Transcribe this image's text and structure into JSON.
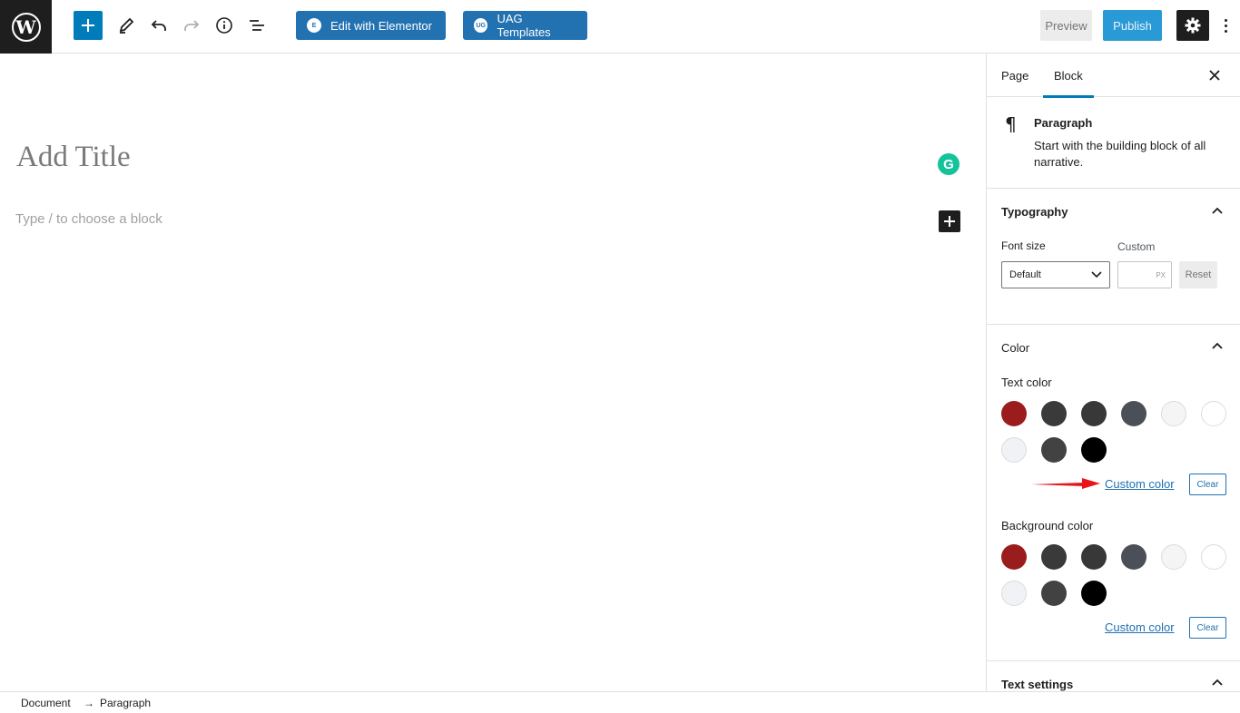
{
  "toolbar": {
    "logo_icon": "wordpress-logo",
    "add_block_icon": "plus-icon",
    "tools": [
      "pencil-icon",
      "undo-icon",
      "redo-icon",
      "info-icon",
      "list-view-icon"
    ],
    "elementor_label": "Edit with Elementor",
    "uag_label": "UAG Templates",
    "uag_badge": "UG",
    "elementor_badge": "E",
    "preview_label": "Preview",
    "publish_label": "Publish",
    "settings_icon": "gear-icon",
    "more_icon": "more-vertical-icon"
  },
  "editor": {
    "title_placeholder": "Add Title",
    "block_placeholder": "Type / to choose a block",
    "grammarly_letter": "G"
  },
  "sidebar": {
    "tabs": [
      {
        "label": "Page"
      },
      {
        "label": "Block"
      }
    ],
    "active_tab": "Block",
    "block": {
      "title": "Paragraph",
      "description": "Start with the building block of all narrative."
    },
    "typography": {
      "heading": "Typography",
      "font_size_label": "Font size",
      "custom_label": "Custom",
      "select_value": "Default",
      "unit": "PX",
      "reset_label": "Reset"
    },
    "color": {
      "heading": "Color",
      "text_color_label": "Text color",
      "background_color_label": "Background color",
      "custom_color_label": "Custom color",
      "clear_label": "Clear",
      "palette": [
        "#9b1c1c",
        "#3a3a3a",
        "#383838",
        "#4b4f58",
        "#f5f5f5",
        "#ffffff",
        "#f0f2f5",
        "#424242",
        "#000000"
      ]
    },
    "text_settings": {
      "heading": "Text settings"
    }
  },
  "footer": {
    "crumbs": [
      "Document",
      "Paragraph"
    ],
    "separator": "→"
  }
}
